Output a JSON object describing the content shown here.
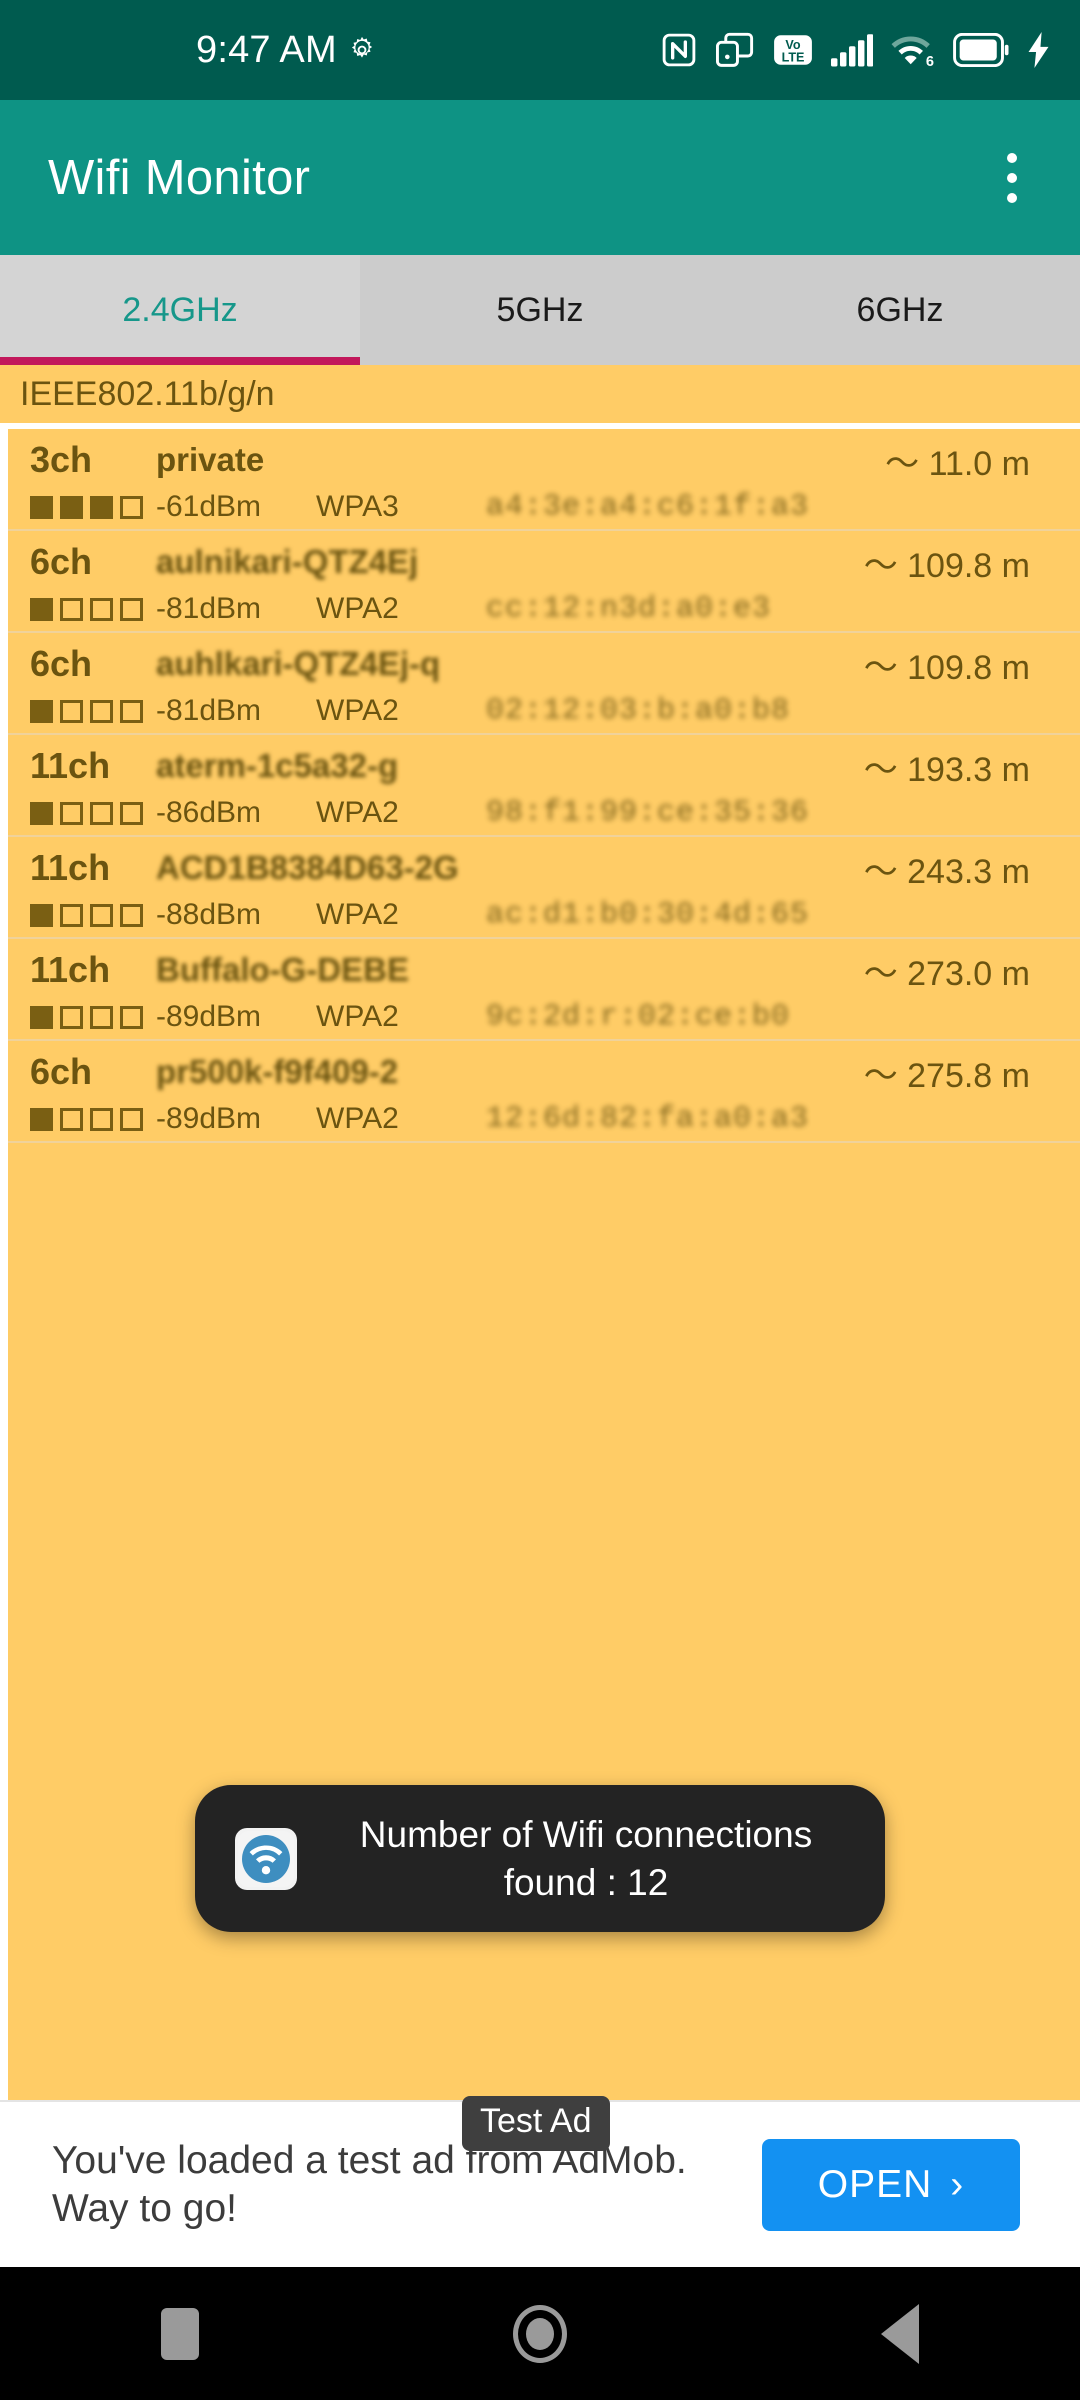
{
  "status_bar": {
    "clock": "9:47 AM",
    "left_icons": [
      "gear-icon"
    ],
    "right_icons": [
      "nfc-icon",
      "screen-cast-icon",
      "volte-icon",
      "cellular-signal-icon",
      "wifi-6-icon",
      "battery-icon",
      "charging-bolt-icon"
    ],
    "volte_label_top": "Vo",
    "volte_label_bottom": "LTE",
    "wifi_generation": "6"
  },
  "app_bar": {
    "title": "Wifi Monitor",
    "overflow_menu": "more-options"
  },
  "tabs": {
    "items": [
      {
        "label": "2.4GHz",
        "active": true
      },
      {
        "label": "5GHz",
        "active": false
      },
      {
        "label": "6GHz",
        "active": false
      }
    ],
    "active_color": "#16978A",
    "indicator_color": "#C2185B"
  },
  "standard_header": {
    "label": "IEEE802.11b/g/n"
  },
  "network_list": {
    "columns": [
      "channel",
      "ssid",
      "distance",
      "signal_bars",
      "dbm",
      "security",
      "mac"
    ],
    "rows": [
      {
        "channel": "3ch",
        "ssid": "private",
        "blurred_ssid": false,
        "distance": "〜 11.0 m",
        "bars_filled": 3,
        "bars_total": 4,
        "dbm": "-61dBm",
        "security": "WPA3",
        "mac": "a4:3e:a4:c6:1f:a3"
      },
      {
        "channel": "6ch",
        "ssid": "aulnikari-QTZ4Ej",
        "blurred_ssid": true,
        "distance": "〜 109.8 m",
        "bars_filled": 1,
        "bars_total": 4,
        "dbm": "-81dBm",
        "security": "WPA2",
        "mac": "cc:12:n3d:a0:e3"
      },
      {
        "channel": "6ch",
        "ssid": "auhlkari-QTZ4Ej-q",
        "blurred_ssid": true,
        "distance": "〜 109.8 m",
        "bars_filled": 1,
        "bars_total": 4,
        "dbm": "-81dBm",
        "security": "WPA2",
        "mac": "02:12:03:b:a0:b8"
      },
      {
        "channel": "11ch",
        "ssid": "aterm-1c5a32-g",
        "blurred_ssid": true,
        "distance": "〜 193.3 m",
        "bars_filled": 1,
        "bars_total": 4,
        "dbm": "-86dBm",
        "security": "WPA2",
        "mac": "98:f1:99:ce:35:36"
      },
      {
        "channel": "11ch",
        "ssid": "ACD1B8384D63-2G",
        "blurred_ssid": true,
        "distance": "〜 243.3 m",
        "bars_filled": 1,
        "bars_total": 4,
        "dbm": "-88dBm",
        "security": "WPA2",
        "mac": "ac:d1:b0:30:4d:65"
      },
      {
        "channel": "11ch",
        "ssid": "Buffalo-G-DEBE",
        "blurred_ssid": true,
        "distance": "〜 273.0 m",
        "bars_filled": 1,
        "bars_total": 4,
        "dbm": "-89dBm",
        "security": "WPA2",
        "mac": "9c:2d:r:02:ce:b0"
      },
      {
        "channel": "6ch",
        "ssid": "pr500k-f9f409-2",
        "blurred_ssid": true,
        "distance": "〜 275.8 m",
        "bars_filled": 1,
        "bars_total": 4,
        "dbm": "-89dBm",
        "security": "WPA2",
        "mac": "12:6d:82:fa:a0:a3"
      }
    ]
  },
  "toast": {
    "icon": "wifi-app-icon",
    "line1": "Number of Wifi connections",
    "line2": "found : 12"
  },
  "ad_banner": {
    "badge": "Test Ad",
    "headline": "You've loaded a test ad from AdMob. Way to go!",
    "cta_label": "OPEN",
    "cta_chevron": "›",
    "cta_color": "#1391F2"
  },
  "nav_bar": {
    "recents": "recents-button",
    "home": "home-button",
    "back": "back-button"
  }
}
